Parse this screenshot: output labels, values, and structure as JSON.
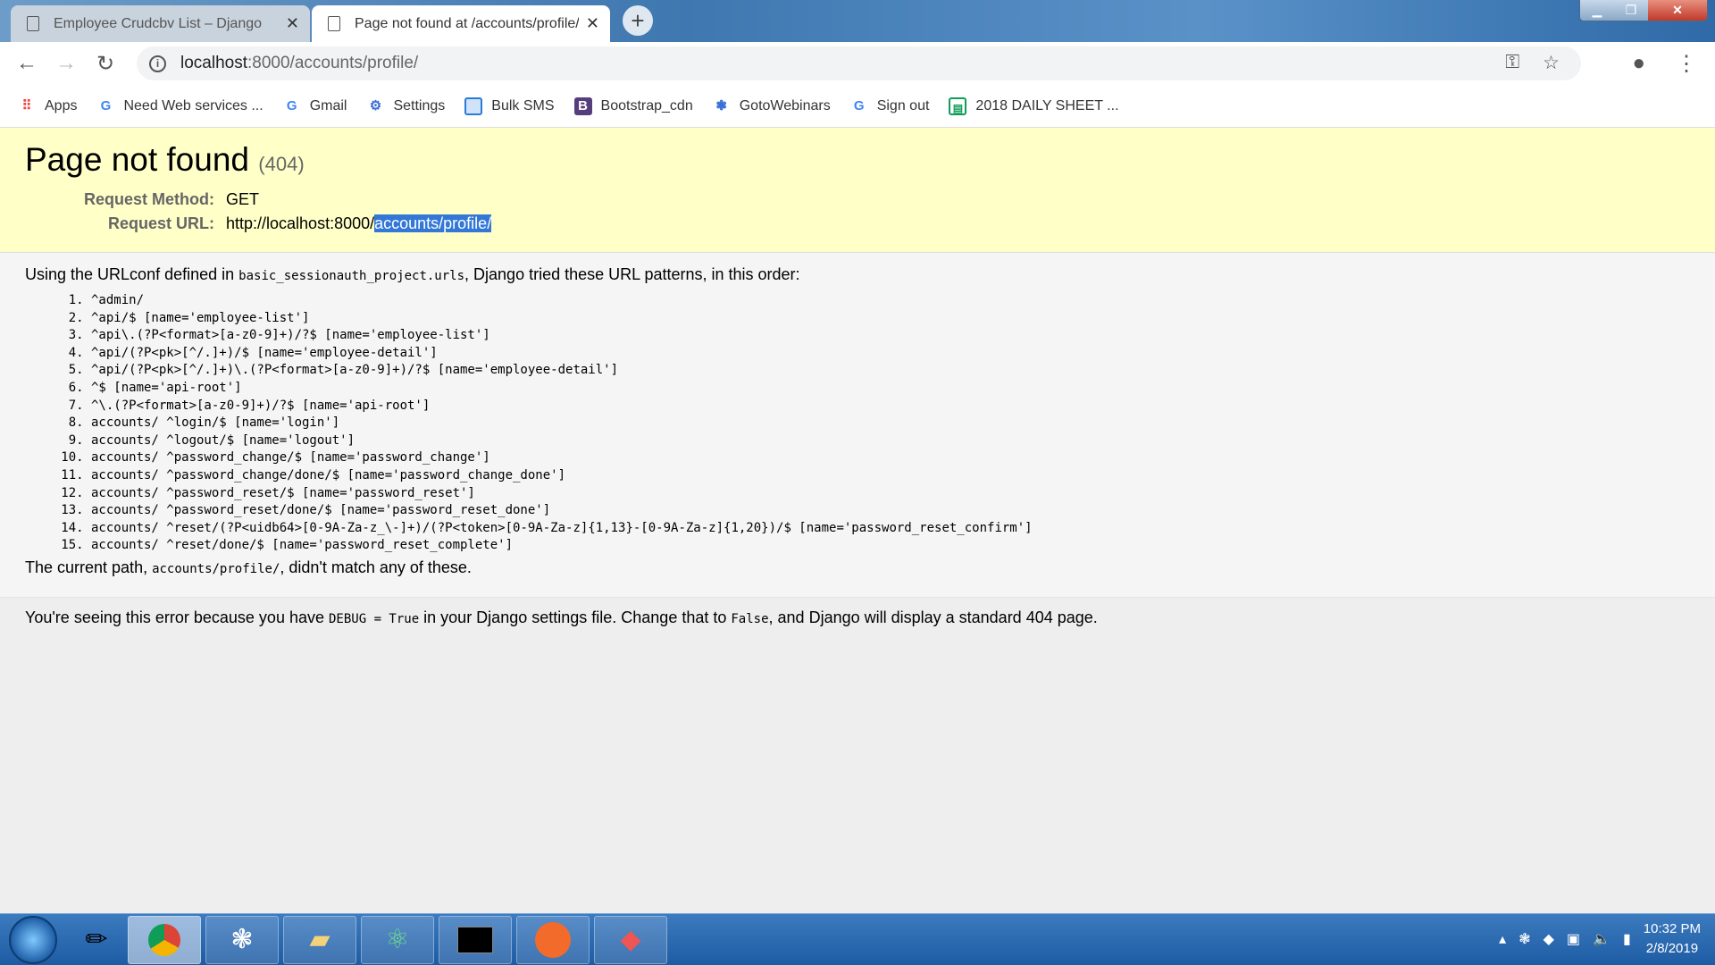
{
  "browser": {
    "tabs": [
      {
        "title": "Employee Crudcbv List – Django"
      },
      {
        "title": "Page not found at /accounts/profile/"
      }
    ],
    "new_tab": "+",
    "address": {
      "host": "localhost",
      "path": ":8000/accounts/profile/"
    },
    "bookmarks": [
      {
        "label": "Apps",
        "icon": "apps-grid-icon"
      },
      {
        "label": "Need Web services ...",
        "icon": "google-icon"
      },
      {
        "label": "Gmail",
        "icon": "google-icon"
      },
      {
        "label": "Settings",
        "icon": "gear-icon"
      },
      {
        "label": "Bulk SMS",
        "icon": "bookmark-app-icon"
      },
      {
        "label": "Bootstrap_cdn",
        "icon": "bootstrap-icon"
      },
      {
        "label": "GotoWebinars",
        "icon": "webinar-icon"
      },
      {
        "label": "Sign out",
        "icon": "google-icon"
      },
      {
        "label": "2018 DAILY SHEET ...",
        "icon": "sheets-icon"
      }
    ]
  },
  "page": {
    "title": "Page not found",
    "code": "(404)",
    "method_label": "Request Method:",
    "method": "GET",
    "url_label": "Request URL:",
    "url_prefix": "http://localhost:8000/",
    "url_selected": "accounts/profile/",
    "intro_a": "Using the URLconf defined in ",
    "intro_code": "basic_sessionauth_project.urls",
    "intro_b": ", Django tried these URL patterns, in this order:",
    "patterns": [
      "^admin/",
      "^api/$ [name='employee-list']",
      "^api\\.(?P<format>[a-z0-9]+)/?$ [name='employee-list']",
      "^api/(?P<pk>[^/.]+)/$ [name='employee-detail']",
      "^api/(?P<pk>[^/.]+)\\.(?P<format>[a-z0-9]+)/?$ [name='employee-detail']",
      "^$ [name='api-root']",
      "^\\.(?P<format>[a-z0-9]+)/?$ [name='api-root']",
      "accounts/ ^login/$ [name='login']",
      "accounts/ ^logout/$ [name='logout']",
      "accounts/ ^password_change/$ [name='password_change']",
      "accounts/ ^password_change/done/$ [name='password_change_done']",
      "accounts/ ^password_reset/$ [name='password_reset']",
      "accounts/ ^password_reset/done/$ [name='password_reset_done']",
      "accounts/ ^reset/(?P<uidb64>[0-9A-Za-z_\\-]+)/(?P<token>[0-9A-Za-z]{1,13}-[0-9A-Za-z]{1,20})/$ [name='password_reset_confirm']",
      "accounts/ ^reset/done/$ [name='password_reset_complete']"
    ],
    "current_a": "The current path, ",
    "current_code": "accounts/profile/",
    "current_b": ", didn't match any of these.",
    "explain_a": "You're seeing this error because you have ",
    "explain_code1": "DEBUG = True",
    "explain_b": " in your Django settings file. Change that to ",
    "explain_code2": "False",
    "explain_c": ", and Django will display a standard 404 page."
  },
  "taskbar": {
    "time": "10:32 PM",
    "date": "2/8/2019"
  }
}
